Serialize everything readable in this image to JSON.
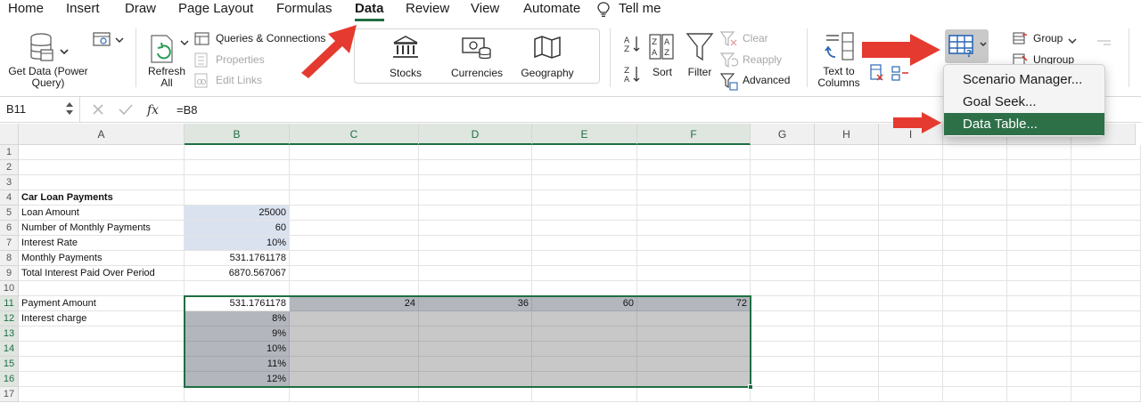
{
  "tabs": [
    "Home",
    "Insert",
    "Draw",
    "Page Layout",
    "Formulas",
    "Data",
    "Review",
    "View",
    "Automate",
    "Tell me"
  ],
  "active_tab": "Data",
  "ribbon": {
    "get_data": "Get Data (Power Query)",
    "refresh_all": "Refresh All",
    "queries_connections": "Queries & Connections",
    "properties": "Properties",
    "edit_links": "Edit Links",
    "stocks": "Stocks",
    "currencies": "Currencies",
    "geography": "Geography",
    "sort": "Sort",
    "filter": "Filter",
    "clear": "Clear",
    "reapply": "Reapply",
    "advanced": "Advanced",
    "text_to_columns": "Text to Columns",
    "group": "Group",
    "ungroup": "Ungroup"
  },
  "formula_bar": {
    "name_box": "B11",
    "formula": "=B8"
  },
  "what_if_menu": {
    "items": [
      "Scenario Manager...",
      "Goal Seek...",
      "Data Table..."
    ],
    "highlighted": "Data Table..."
  },
  "columns": [
    "A",
    "B",
    "C",
    "D",
    "E",
    "F",
    "G",
    "H",
    "I"
  ],
  "rows": [
    "1",
    "2",
    "3",
    "4",
    "5",
    "6",
    "7",
    "8",
    "9",
    "10",
    "11",
    "12",
    "13",
    "14",
    "15",
    "16",
    "17"
  ],
  "cells": {
    "A4": "Car Loan Payments",
    "A5": "Loan Amount",
    "A6": "Number of Monthly Payments",
    "A7": "Interest Rate",
    "A8": "Monthly Payments",
    "A9": "Total Interest Paid Over Period",
    "A11": "Payment Amount",
    "A12": "Interest charge",
    "B5": "25000",
    "B6": "60",
    "B7": "10%",
    "B8": "531.1761178",
    "B9": "6870.567067",
    "B11": "531.1761178",
    "C11": "24",
    "D11": "36",
    "E11": "60",
    "F11": "72",
    "B12": "8%",
    "B13": "9%",
    "B14": "10%",
    "B15": "11%",
    "B16": "12%"
  },
  "colors": {
    "accent_green": "#1f6e43",
    "menu_highlight": "#2d7048",
    "arrow_red": "#e53a2f",
    "input_blue": "#dbe2ef",
    "selection_gray": "#c8c8c8"
  }
}
